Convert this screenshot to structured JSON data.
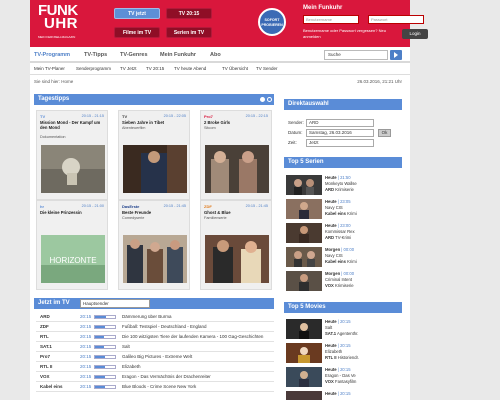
{
  "header": {
    "logo_line1": "FUNK",
    "logo_line2": "UHR",
    "logo_sub": "MEIN FERNSEH-MAGAZIN",
    "buttons": [
      {
        "label": "TV jetzt"
      },
      {
        "label": "TV 20:15"
      },
      {
        "label": "Filme im TV"
      },
      {
        "label": "Serien im TV"
      }
    ],
    "sofort_label": "SOFORT PROBIEREN",
    "mein_funkuhr": "Mein Funkuhr",
    "username_placeholder": "Benutzername",
    "password_placeholder": "Passwort",
    "note": "Benutzername oder Passwort vergessen? Neu anmelden",
    "login_label": "Login"
  },
  "nav": {
    "items": [
      "TV-Programm",
      "TV-Tipps",
      "TV-Genres",
      "Mein Funkuhr",
      "Abo"
    ],
    "search_value": "Suche"
  },
  "subnav": {
    "items": [
      "Mein TV-Planer",
      "Senderprogramm",
      "TV Jetzt",
      "TV 20:15",
      "TV heute Abend",
      "TV Übersicht",
      "TV Sender"
    ]
  },
  "breadcrumb": "Sie sind hier: Home",
  "datetime": "26.03.2016, 21:21 Uhr",
  "tagestipps": {
    "title": "Tagestipps",
    "items": [
      {
        "channel": "TV",
        "time": "20:15 - 21:15",
        "title": "Mission Mond - Der Kampf um den Mond",
        "genre": "Dokumentation",
        "img": "moon"
      },
      {
        "channel": "TV",
        "time": "20:15 - 22:05",
        "title": "Sieben Jahre in Tibet",
        "genre": "Abenteuerfilm",
        "img": "tibet"
      },
      {
        "channel": "Pro7",
        "time": "20:15 - 22:15",
        "title": "2 Broke Girls",
        "genre": "Sitcom",
        "img": "girls"
      },
      {
        "channel": "hr",
        "time": "20:15 - 21:00",
        "title": "Die kleine Prinzessin",
        "genre": "",
        "img": "horizonte"
      },
      {
        "channel": "DasErste",
        "time": "20:15 - 21:45",
        "title": "Beste Freunde",
        "genre": "Comedyserie",
        "img": "freunde"
      },
      {
        "channel": "ZDF",
        "time": "20:15 - 21:45",
        "title": "Ghost & Blue",
        "genre": "Familienserie",
        "img": "ghost"
      }
    ]
  },
  "jetzt_im_tv": {
    "title": "Jetzt im TV",
    "select_value": "Hauptsender",
    "rows": [
      {
        "channel": "ARD",
        "time": "20:15",
        "progress": 0.55,
        "show": "Dämmerung über Burma"
      },
      {
        "channel": "ZDF",
        "time": "20:15",
        "progress": 0.5,
        "show": "Fußball: Testspiel - Deutschland - England"
      },
      {
        "channel": "RTL",
        "time": "20:15",
        "progress": 0.45,
        "show": "Die 100 witzigsten Tiere der laufenden Kamera - 100 Gag-Geschichten"
      },
      {
        "channel": "SAT.1",
        "time": "20:15",
        "progress": 0.45,
        "show": "Salt"
      },
      {
        "channel": "Pro7",
        "time": "20:15",
        "progress": 0.5,
        "show": "Galileo Big Pictures - Extreme Welt"
      },
      {
        "channel": "RTL II",
        "time": "20:15",
        "progress": 0.5,
        "show": "Elizabeth"
      },
      {
        "channel": "VOX",
        "time": "20:15",
        "progress": 0.5,
        "show": "Eragon - Das Vermächtnis der Drachenreiter"
      },
      {
        "channel": "Kabel eins",
        "time": "20:15",
        "progress": 0.5,
        "show": "Blue Bloods - Crime Scene New York"
      }
    ]
  },
  "direktauswahl": {
    "title": "Direktauswahl",
    "sender_label": "Sender:",
    "sender_value": "ARD",
    "datum_label": "Datum:",
    "datum_value": "Samstag, 26.03.2016",
    "zeit_label": "Zeit:",
    "zeit_value": "Jetzt",
    "ok_label": "Ok"
  },
  "top_serien": {
    "title": "Top 5 Serien",
    "items": [
      {
        "day": "Heute",
        "time": "21:50",
        "title": "Monkeyto Wallse",
        "channel": "ARD",
        "genre": "Krimiserie"
      },
      {
        "day": "Heute",
        "time": "23:05",
        "title": "Navy CIS",
        "channel": "Kabel eins",
        "genre": "Krimi"
      },
      {
        "day": "Heute",
        "time": "23:00",
        "title": "Kommissar Rex",
        "channel": "ARD",
        "genre": "TV-Krimi"
      },
      {
        "day": "Morgen",
        "time": "00:00",
        "title": "Navy CIS",
        "channel": "Kabel eins",
        "genre": "Krimi"
      },
      {
        "day": "Morgen",
        "time": "00:00",
        "title": "Criminal Intent",
        "channel": "VOX",
        "genre": "Krimiserie"
      }
    ]
  },
  "top_movies": {
    "title": "Top 5 Movies",
    "items": [
      {
        "day": "Heute",
        "time": "20:15",
        "title": "Salt",
        "channel": "SAT.1",
        "genre": "Agententhr."
      },
      {
        "day": "Heute",
        "time": "20:15",
        "title": "Elizabeth",
        "channel": "RTL II",
        "genre": "Historiendr."
      },
      {
        "day": "Heute",
        "time": "20:15",
        "title": "Eragon - Das Ve",
        "channel": "VOX",
        "genre": "Fantasyfilm"
      },
      {
        "day": "Heute",
        "time": "20:15",
        "title": "",
        "channel": "",
        "genre": ""
      }
    ]
  },
  "colors": {
    "brand_red": "#d9173c",
    "accent_blue": "#5a8cd7"
  }
}
